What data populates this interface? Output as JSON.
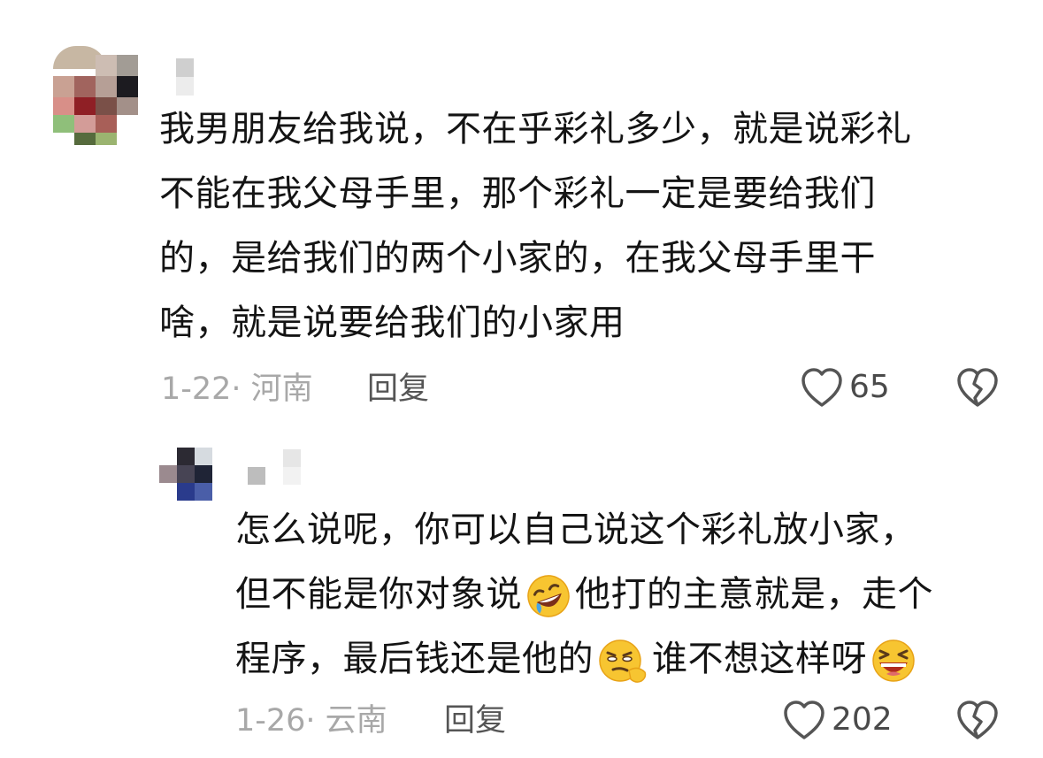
{
  "comments": [
    {
      "text_lines": [
        "我男朋友给我说，不在乎彩礼多少，就是说彩礼",
        "不能在我父母手里，那个彩礼一定是要给我们",
        "的，是给我们的两个小家的，在我父母手里干",
        "啥，就是说要给我们的小家用"
      ],
      "meta": "1-22· 河南",
      "reply_label": "回复",
      "likes": "65"
    },
    {
      "text_lines": [
        {
          "before": "怎么说呢，你可以自己说这个彩礼放小家，",
          "after": ""
        },
        {
          "before": "但不能是你对象说",
          "emoji": "rofl-emoji",
          "after": "他打的主意就是，走个"
        },
        {
          "before": "程序，最后钱还是他的",
          "emoji": "smirk-emoji",
          "mid": "谁不想这样呀",
          "emoji2": "laugh-emoji"
        }
      ],
      "meta": "1-26· 云南",
      "reply_label": "回复",
      "likes": "202"
    }
  ],
  "colors": {
    "text": "#141414",
    "meta": "#a8a8a8",
    "reply": "#555555",
    "icon": "#555555",
    "emoji": "#f7c531"
  }
}
